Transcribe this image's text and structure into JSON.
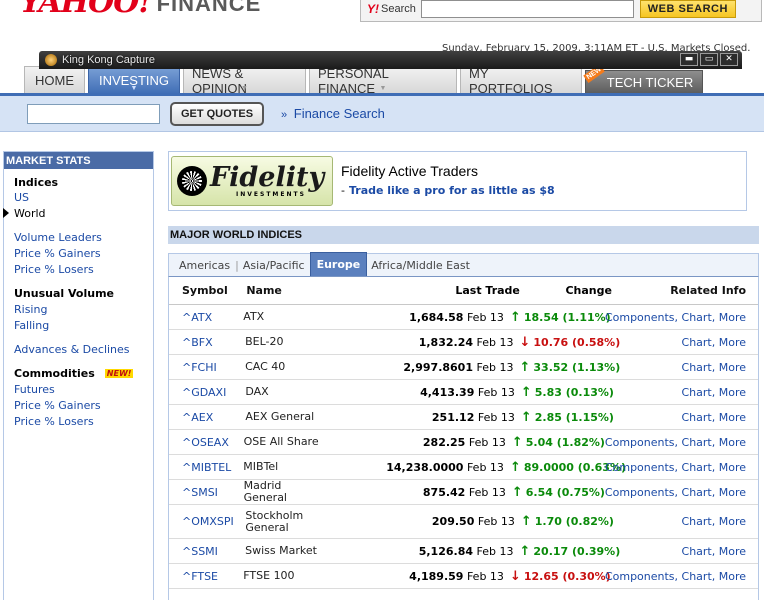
{
  "header": {
    "brand_yahoo": "YAHOO!",
    "brand_finance": "FINANCE",
    "search_label": "Search",
    "search_value": "",
    "web_search_button": "WEB SEARCH",
    "datetime_partial": "Sunday, February 15, 2009, 3:11AM ET - U.S. Markets Closed."
  },
  "capture_window": {
    "title": "King Kong Capture",
    "buttons": [
      "▬",
      "▭",
      "✕"
    ]
  },
  "nav": {
    "tabs": [
      {
        "label": "HOME"
      },
      {
        "label": "INVESTING"
      },
      {
        "label": "NEWS & OPINION"
      },
      {
        "label": "PERSONAL FINANCE"
      },
      {
        "label": "MY PORTFOLIOS"
      },
      {
        "label": "TECH TICKER"
      }
    ],
    "new_badge": "NEW"
  },
  "quotebar": {
    "input_value": "",
    "get_quotes": "GET QUOTES",
    "finance_search": "Finance Search",
    "finance_search_prefix": "»"
  },
  "sidebar": {
    "title": "MARKET STATS",
    "indices_head": "Indices",
    "us": "US",
    "world": "World",
    "volume_leaders": "Volume Leaders",
    "price_gainers": "Price % Gainers",
    "price_losers": "Price % Losers",
    "unusual_volume": "Unusual Volume",
    "rising": "Rising",
    "falling": "Falling",
    "advances_declines": "Advances & Declines",
    "commodities": "Commodities",
    "new_tag": "NEW!",
    "futures": "Futures",
    "c_price_gainers": "Price % Gainers",
    "c_price_losers": "Price % Losers"
  },
  "ad": {
    "logo_word": "Fidelity",
    "logo_sub": "INVESTMENTS",
    "headline": "Fidelity Active Traders",
    "dash": "-",
    "tagline": "Trade like a pro for as little as $8"
  },
  "section": {
    "title": "MAJOR WORLD INDICES",
    "tabs": [
      "Americas",
      "Asia/Pacific",
      "Europe",
      "Africa/Middle East"
    ],
    "separator": "|"
  },
  "table": {
    "columns": {
      "symbol": "Symbol",
      "name": "Name",
      "last_trade": "Last Trade",
      "change": "Change",
      "related": "Related Info"
    },
    "rows": [
      {
        "symbol": "^ATX",
        "name": "ATX",
        "last": "1,684.58",
        "date": "Feb 13",
        "dir": "up",
        "chg": "18.54 (1.11%)",
        "related": "Components, Chart, More"
      },
      {
        "symbol": "^BFX",
        "name": "BEL-20",
        "last": "1,832.24",
        "date": "Feb 13",
        "dir": "down",
        "chg": "10.76 (0.58%)",
        "related": "Chart, More"
      },
      {
        "symbol": "^FCHI",
        "name": "CAC 40",
        "last": "2,997.8601",
        "date": "Feb 13",
        "dir": "up",
        "chg": "33.52 (1.13%)",
        "related": "Chart, More"
      },
      {
        "symbol": "^GDAXI",
        "name": "DAX",
        "last": "4,413.39",
        "date": "Feb 13",
        "dir": "up",
        "chg": "5.83 (0.13%)",
        "related": "Chart, More"
      },
      {
        "symbol": "^AEX",
        "name": "AEX General",
        "last": "251.12",
        "date": "Feb 13",
        "dir": "up",
        "chg": "2.85 (1.15%)",
        "related": "Chart, More"
      },
      {
        "symbol": "^OSEAX",
        "name": "OSE All Share",
        "last": "282.25",
        "date": "Feb 13",
        "dir": "up",
        "chg": "5.04 (1.82%)",
        "related": "Components, Chart, More"
      },
      {
        "symbol": "^MIBTEL",
        "name": "MIBTel",
        "last": "14,238.0000",
        "date": "Feb 13",
        "dir": "up",
        "chg": "89.0000 (0.63%)",
        "related": "Components, Chart, More"
      },
      {
        "symbol": "^SMSI",
        "name": "Madrid General",
        "last": "875.42",
        "date": "Feb 13",
        "dir": "up",
        "chg": "6.54 (0.75%)",
        "related": "Components, Chart, More"
      },
      {
        "symbol": "^OMXSPI",
        "name": "Stockholm General",
        "last": "209.50",
        "date": "Feb 13",
        "dir": "up",
        "chg": "1.70 (0.82%)",
        "related": "Chart, More"
      },
      {
        "symbol": "^SSMI",
        "name": "Swiss Market",
        "last": "5,126.84",
        "date": "Feb 13",
        "dir": "up",
        "chg": "20.17 (0.39%)",
        "related": "Chart, More"
      },
      {
        "symbol": "^FTSE",
        "name": "FTSE 100",
        "last": "4,189.59",
        "date": "Feb 13",
        "dir": "down",
        "chg": "12.65 (0.30%)",
        "related": "Components, Chart, More"
      }
    ]
  },
  "colors": {
    "up": "#0a8a0a",
    "down": "#c81010",
    "link": "#1b4aa5",
    "nav_active": "#3f6db5",
    "brand_red": "#e2001a"
  }
}
